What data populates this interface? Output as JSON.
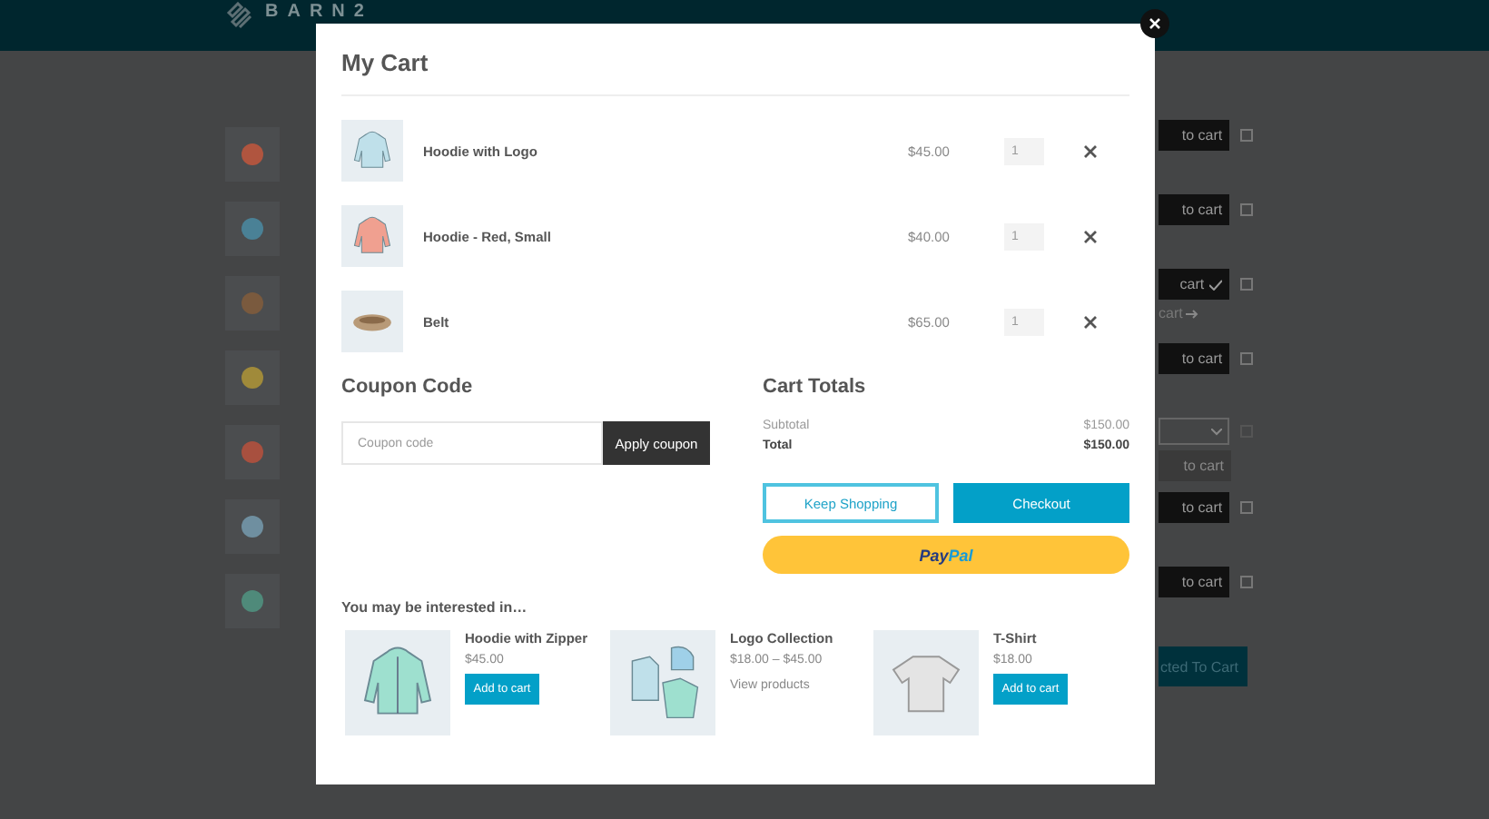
{
  "header": {
    "logo": "BARN2"
  },
  "background": {
    "rows": [
      {
        "kind": "button",
        "label": "to cart",
        "checked": false,
        "color": "#b0553f"
      },
      {
        "kind": "button",
        "label": "to cart",
        "checked": false,
        "color": "#4a8196"
      },
      {
        "kind": "added",
        "label": "cart",
        "link": "cart",
        "checked": false,
        "color": "#7a5a3e"
      },
      {
        "kind": "button",
        "label": "to cart",
        "checked": false,
        "color": "#a08a3a"
      },
      {
        "kind": "select",
        "label": "to cart",
        "checked": false,
        "color": "#a8503f"
      },
      {
        "kind": "button",
        "label": "to cart",
        "checked": false,
        "color": "#6f8fa0"
      },
      {
        "kind": "button",
        "label": "to cart",
        "checked": false,
        "color": "#4f8a7a"
      }
    ],
    "bulk_button": "cted To Cart"
  },
  "cart": {
    "title": "My Cart",
    "items": [
      {
        "name": "Hoodie with Logo",
        "price": "$45.00",
        "quantity": "1",
        "kind": "hoodie",
        "color": "#bfe0ea"
      },
      {
        "name": "Hoodie - Red, Small",
        "price": "$40.00",
        "quantity": "1",
        "kind": "hoodie",
        "color": "#f0a090"
      },
      {
        "name": "Belt",
        "price": "$65.00",
        "quantity": "1",
        "kind": "belt",
        "color": "#b89a78"
      }
    ],
    "coupon": {
      "title": "Coupon Code",
      "placeholder": "Coupon code",
      "button": "Apply coupon"
    },
    "totals": {
      "title": "Cart Totals",
      "rows": [
        {
          "label": "Subtotal",
          "value": "$150.00",
          "kind": "subtotal"
        },
        {
          "label": "Total",
          "value": "$150.00",
          "kind": "total"
        }
      ]
    },
    "buttons": {
      "keep_shopping": "Keep Shopping",
      "checkout": "Checkout",
      "paypal_left": "Pay",
      "paypal_right": "Pal"
    },
    "suggestions": {
      "title": "You may be interested in…",
      "products": [
        {
          "name": "Hoodie with Zipper",
          "price": "$45.00",
          "button": "Add to cart",
          "kind": "zipper"
        },
        {
          "name": "Logo Collection",
          "price": "$18.00 – $45.00",
          "link": "View products",
          "kind": "collection"
        },
        {
          "name": "T-Shirt",
          "price": "$18.00",
          "button": "Add to cart",
          "kind": "tshirt"
        }
      ]
    }
  }
}
